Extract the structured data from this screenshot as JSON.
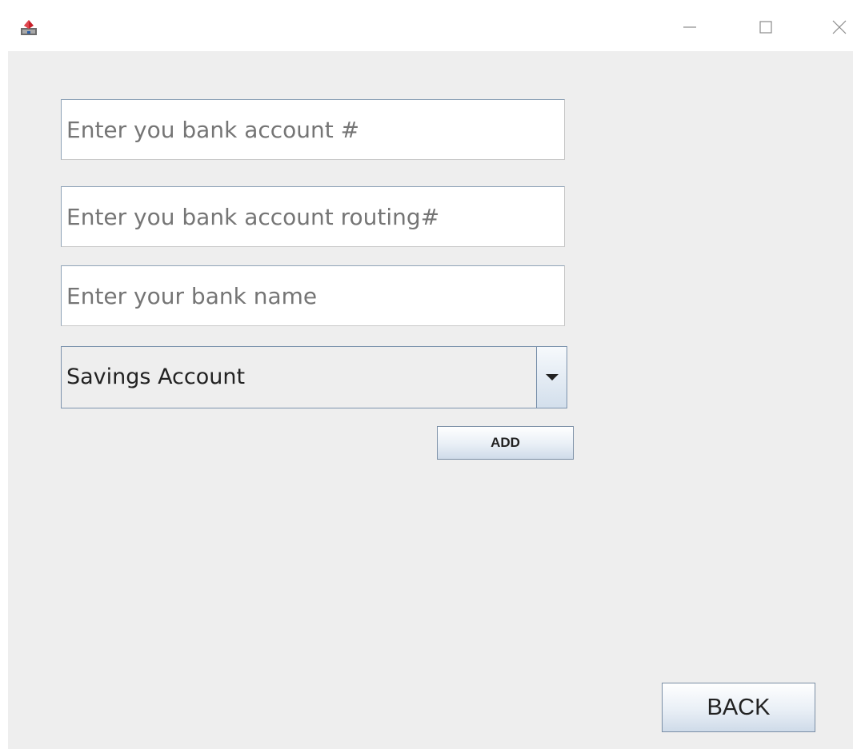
{
  "window": {
    "icons": {
      "app": "java-app-icon",
      "minimize": "minimize-icon",
      "maximize": "maximize-icon",
      "close": "close-icon"
    }
  },
  "form": {
    "account_number_placeholder": "Enter you bank account #",
    "routing_number_placeholder": "Enter you bank account routing#",
    "bank_name_placeholder": "Enter your bank name",
    "account_type_selected": "Savings Account",
    "add_label": "ADD",
    "back_label": "BACK"
  }
}
